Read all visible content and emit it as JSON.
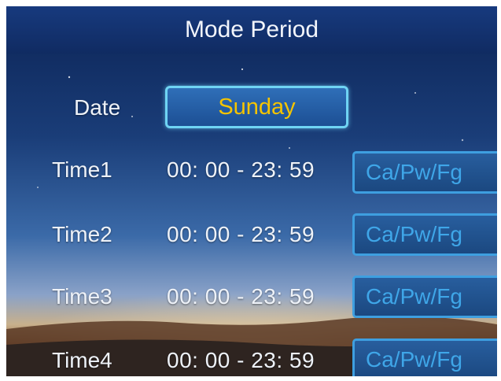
{
  "title": "Mode Period",
  "date": {
    "label": "Date",
    "value": "Sunday"
  },
  "time_rows": [
    {
      "label": "Time1",
      "range": "00: 00 - 23: 59",
      "mode": "Ca/Pw/Fg"
    },
    {
      "label": "Time2",
      "range": "00: 00 - 23: 59",
      "mode": "Ca/Pw/Fg"
    },
    {
      "label": "Time3",
      "range": "00: 00 - 23: 59",
      "mode": "Ca/Pw/Fg"
    },
    {
      "label": "Time4",
      "range": "00: 00 - 23: 59",
      "mode": "Ca/Pw/Fg"
    }
  ],
  "colors": {
    "title_bar": "#173a7e",
    "date_value": "#f5c400",
    "date_border": "#6fd4f4",
    "mode_text": "#3fa6e8",
    "mode_border": "#3e9fe0"
  }
}
